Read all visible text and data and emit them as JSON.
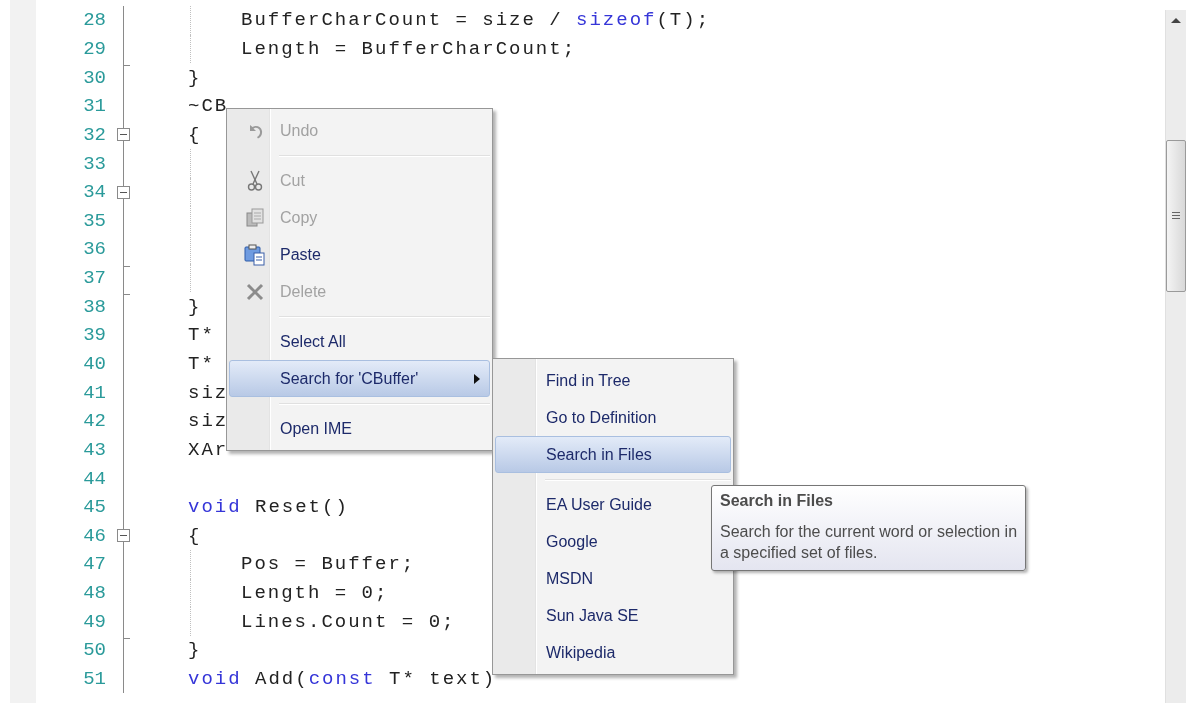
{
  "editor": {
    "lines": [
      {
        "number": "28",
        "nested": true,
        "tokens": [
          {
            "text": "BufferCharCount = size / ",
            "kind": "plain"
          },
          {
            "text": "sizeof",
            "kind": "keyword"
          },
          {
            "text": "(T);",
            "kind": "plain"
          }
        ]
      },
      {
        "number": "29",
        "nested": true,
        "tokens": [
          {
            "text": "Length = BufferCharCount;",
            "kind": "plain"
          }
        ]
      },
      {
        "number": "30",
        "nested": false,
        "fold_end": true,
        "tokens": [
          {
            "text": "}",
            "kind": "plain"
          }
        ]
      },
      {
        "number": "31",
        "nested": false,
        "tokens": [
          {
            "text": "~CB",
            "kind": "plain"
          }
        ]
      },
      {
        "number": "32",
        "nested": false,
        "fold_box": true,
        "tokens": [
          {
            "text": "{",
            "kind": "plain"
          }
        ]
      },
      {
        "number": "33",
        "nested": true
      },
      {
        "number": "34",
        "nested": true,
        "fold_box": true
      },
      {
        "number": "35",
        "nested": true
      },
      {
        "number": "36",
        "nested": true
      },
      {
        "number": "37",
        "nested": true,
        "fold_end": true
      },
      {
        "number": "38",
        "nested": false,
        "fold_end": true,
        "tokens": [
          {
            "text": "}",
            "kind": "plain"
          }
        ]
      },
      {
        "number": "39",
        "nested": false,
        "tokens": [
          {
            "text": "T*",
            "kind": "plain"
          }
        ]
      },
      {
        "number": "40",
        "nested": false,
        "tokens": [
          {
            "text": "T*",
            "kind": "plain"
          }
        ]
      },
      {
        "number": "41",
        "nested": false,
        "tokens": [
          {
            "text": "siz",
            "kind": "plain"
          }
        ]
      },
      {
        "number": "42",
        "nested": false,
        "tokens": [
          {
            "text": "siz",
            "kind": "plain"
          }
        ]
      },
      {
        "number": "43",
        "nested": false,
        "tokens": [
          {
            "text": "XAr",
            "kind": "plain"
          }
        ]
      },
      {
        "number": "44"
      },
      {
        "number": "45",
        "nested": false,
        "tokens": [
          {
            "text": "void",
            "kind": "keyword"
          },
          {
            "text": " Reset()",
            "kind": "plain"
          }
        ]
      },
      {
        "number": "46",
        "nested": false,
        "fold_box": true,
        "tokens": [
          {
            "text": "{",
            "kind": "plain"
          }
        ]
      },
      {
        "number": "47",
        "nested": true,
        "tokens": [
          {
            "text": "Pos = Buffer;",
            "kind": "plain"
          }
        ]
      },
      {
        "number": "48",
        "nested": true,
        "tokens": [
          {
            "text": "Length = 0;",
            "kind": "plain"
          }
        ]
      },
      {
        "number": "49",
        "nested": true,
        "tokens": [
          {
            "text": "Lines.Count = 0;",
            "kind": "plain"
          }
        ]
      },
      {
        "number": "50",
        "nested": false,
        "fold_end": true,
        "tokens": [
          {
            "text": "}",
            "kind": "plain"
          }
        ]
      },
      {
        "number": "51",
        "nested": false,
        "tokens": [
          {
            "text": "void",
            "kind": "keyword"
          },
          {
            "text": " Add(",
            "kind": "plain"
          },
          {
            "text": "const",
            "kind": "keyword"
          },
          {
            "text": " T* text)",
            "kind": "plain"
          }
        ]
      }
    ]
  },
  "context_menu": {
    "items": [
      {
        "kind": "item",
        "label": "Undo",
        "disabled": true,
        "selected": false,
        "submenu": false
      },
      {
        "kind": "separator"
      },
      {
        "kind": "item",
        "label": "Cut",
        "disabled": true,
        "selected": false,
        "submenu": false
      },
      {
        "kind": "item",
        "label": "Copy",
        "disabled": true,
        "selected": false,
        "submenu": false
      },
      {
        "kind": "item",
        "label": "Paste",
        "disabled": false,
        "selected": false,
        "submenu": false
      },
      {
        "kind": "item",
        "label": "Delete",
        "disabled": true,
        "selected": false,
        "submenu": false
      },
      {
        "kind": "separator"
      },
      {
        "kind": "item",
        "label": "Select All",
        "disabled": false,
        "selected": false,
        "submenu": false
      },
      {
        "kind": "item",
        "label": "Search for 'CBuffer'",
        "disabled": false,
        "selected": true,
        "submenu": true
      },
      {
        "kind": "separator"
      },
      {
        "kind": "item",
        "label": "Open IME",
        "disabled": false,
        "selected": false,
        "submenu": false
      }
    ]
  },
  "submenu": {
    "items": [
      {
        "kind": "item",
        "label": "Find in Tree",
        "selected": false
      },
      {
        "kind": "item",
        "label": "Go to Definition",
        "selected": false
      },
      {
        "kind": "item",
        "label": "Search in Files",
        "selected": true
      },
      {
        "kind": "separator"
      },
      {
        "kind": "item",
        "label": "EA User Guide",
        "selected": false
      },
      {
        "kind": "item",
        "label": "Google",
        "selected": false
      },
      {
        "kind": "item",
        "label": "MSDN",
        "selected": false
      },
      {
        "kind": "item",
        "label": "Sun Java SE",
        "selected": false
      },
      {
        "kind": "item",
        "label": "Wikipedia",
        "selected": false
      }
    ]
  },
  "tooltip": {
    "title": "Search in Files",
    "text": "Search for the current word or selection in a specified set of files."
  }
}
